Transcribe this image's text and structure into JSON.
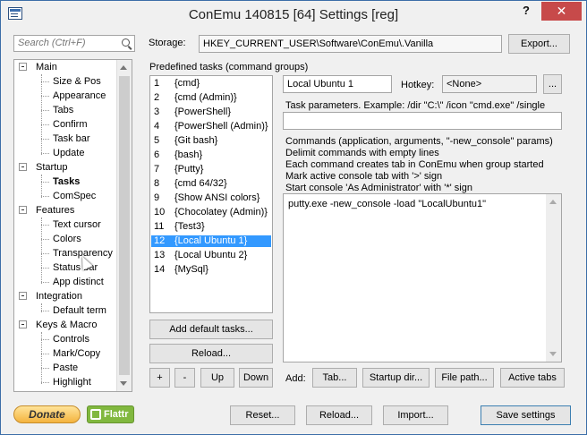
{
  "window": {
    "title": "ConEmu 140815 [64] Settings [reg]",
    "help_icon": "help-icon",
    "close_icon": "close-icon"
  },
  "search": {
    "placeholder": "Search (Ctrl+F)",
    "icon": "search-icon"
  },
  "storage": {
    "label": "Storage:",
    "value": "HKEY_CURRENT_USER\\Software\\ConEmu\\.Vanilla",
    "export_label": "Export..."
  },
  "tree": [
    {
      "label": "Main",
      "level": 0,
      "expanded": true
    },
    {
      "label": "Size & Pos",
      "level": 1
    },
    {
      "label": "Appearance",
      "level": 1
    },
    {
      "label": "Tabs",
      "level": 1
    },
    {
      "label": "Confirm",
      "level": 1
    },
    {
      "label": "Task bar",
      "level": 1
    },
    {
      "label": "Update",
      "level": 1
    },
    {
      "label": "Startup",
      "level": 0,
      "expanded": true
    },
    {
      "label": "Tasks",
      "level": 1,
      "selected": true
    },
    {
      "label": "ComSpec",
      "level": 1
    },
    {
      "label": "Features",
      "level": 0,
      "expanded": true
    },
    {
      "label": "Text cursor",
      "level": 1
    },
    {
      "label": "Colors",
      "level": 1
    },
    {
      "label": "Transparency",
      "level": 1
    },
    {
      "label": "Status bar",
      "level": 1
    },
    {
      "label": "App distinct",
      "level": 1
    },
    {
      "label": "Integration",
      "level": 0,
      "expanded": true
    },
    {
      "label": "Default term",
      "level": 1
    },
    {
      "label": "Keys & Macro",
      "level": 0,
      "expanded": true
    },
    {
      "label": "Controls",
      "level": 1
    },
    {
      "label": "Mark/Copy",
      "level": 1
    },
    {
      "label": "Paste",
      "level": 1
    },
    {
      "label": "Highlight",
      "level": 1
    }
  ],
  "tasks_panel": {
    "label": "Predefined tasks (command groups)",
    "items": [
      {
        "num": "1",
        "name": "{cmd}"
      },
      {
        "num": "2",
        "name": "{cmd (Admin)}"
      },
      {
        "num": "3",
        "name": "{PowerShell}"
      },
      {
        "num": "4",
        "name": "{PowerShell (Admin)}"
      },
      {
        "num": "5",
        "name": "{Git bash}"
      },
      {
        "num": "6",
        "name": "{bash}"
      },
      {
        "num": "7",
        "name": "{Putty}"
      },
      {
        "num": "8",
        "name": "{cmd 64/32}"
      },
      {
        "num": "9",
        "name": "{Show ANSI colors}"
      },
      {
        "num": "10",
        "name": "{Chocolatey (Admin)}"
      },
      {
        "num": "11",
        "name": "{Test3}"
      },
      {
        "num": "12",
        "name": "{Local Ubuntu 1}",
        "selected": true
      },
      {
        "num": "13",
        "name": "{Local Ubuntu 2}"
      },
      {
        "num": "14",
        "name": "{MySql}"
      }
    ],
    "add_default_label": "Add default tasks...",
    "reload_label": "Reload...",
    "plus_label": "+",
    "minus_label": "-",
    "up_label": "Up",
    "down_label": "Down"
  },
  "task_editor": {
    "name_value": "Local Ubuntu 1",
    "hotkey_label": "Hotkey:",
    "hotkey_value": "<None>",
    "hotkey_button": "...",
    "params_label": "Task parameters. Example: /dir \"C:\\\" /icon \"cmd.exe\" /single",
    "params_value": "",
    "help": [
      "Commands (application, arguments, \"-new_console\" params)",
      "Delimit commands with empty lines",
      "Each command creates tab in ConEmu when group started",
      "Mark active console tab with '>' sign",
      "Start console 'As Administrator' with '*' sign"
    ],
    "commands": "putty.exe -new_console -load \"LocalUbuntu1\"",
    "add_label": "Add:",
    "add_tab": "Tab...",
    "add_startup_dir": "Startup dir...",
    "add_file_path": "File path...",
    "add_active_tabs": "Active tabs"
  },
  "footer": {
    "donate_label": "Donate",
    "flattr_label": "Flattr",
    "reset_label": "Reset...",
    "reload_label": "Reload...",
    "import_label": "Import...",
    "save_label": "Save settings"
  }
}
